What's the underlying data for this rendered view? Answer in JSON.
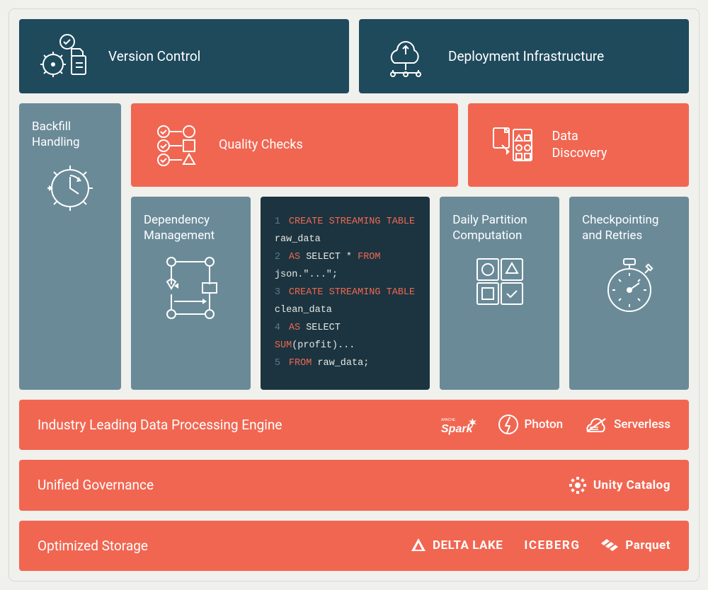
{
  "top": {
    "version_control": "Version Control",
    "deployment": "Deployment Infrastructure"
  },
  "mid": {
    "backfill": "Backfill\nHandling",
    "quality": "Quality Checks",
    "discovery": "Data\nDiscovery",
    "dependency": "Dependency\nManagement",
    "partition": "Daily Partition\nComputation",
    "checkpoint": "Checkpointing\nand Retries"
  },
  "code": {
    "lines": [
      {
        "n": "1",
        "t": [
          {
            "c": "kw",
            "v": "CREATE STREAMING TABLE"
          },
          {
            "c": "",
            "v": " raw_data"
          }
        ]
      },
      {
        "n": "2",
        "t": [
          {
            "c": "kw",
            "v": "AS"
          },
          {
            "c": "",
            "v": " SELECT * "
          },
          {
            "c": "kw",
            "v": "FROM"
          },
          {
            "c": "",
            "v": " json.\"...\";"
          }
        ]
      },
      {
        "n": "3",
        "t": [
          {
            "c": "kw",
            "v": "CREATE STREAMING TABLE"
          },
          {
            "c": "",
            "v": " clean_data"
          }
        ]
      },
      {
        "n": "4",
        "t": [
          {
            "c": "kw",
            "v": "AS"
          },
          {
            "c": "",
            "v": " SELECT "
          },
          {
            "c": "kw",
            "v": "SUM"
          },
          {
            "c": "",
            "v": "(profit)..."
          }
        ]
      },
      {
        "n": "5",
        "t": [
          {
            "c": "kw",
            "v": "FROM"
          },
          {
            "c": "",
            "v": " raw_data;"
          }
        ]
      }
    ]
  },
  "bottom": {
    "processing": {
      "title": "Industry Leading Data Processing Engine",
      "items": [
        "Spark",
        "Photon",
        "Serverless"
      ]
    },
    "governance": {
      "title": "Unified Governance",
      "catalog": "Unity Catalog"
    },
    "storage": {
      "title": "Optimized Storage",
      "items": [
        "DELTA LAKE",
        "ICEBERG",
        "Parquet"
      ]
    }
  }
}
